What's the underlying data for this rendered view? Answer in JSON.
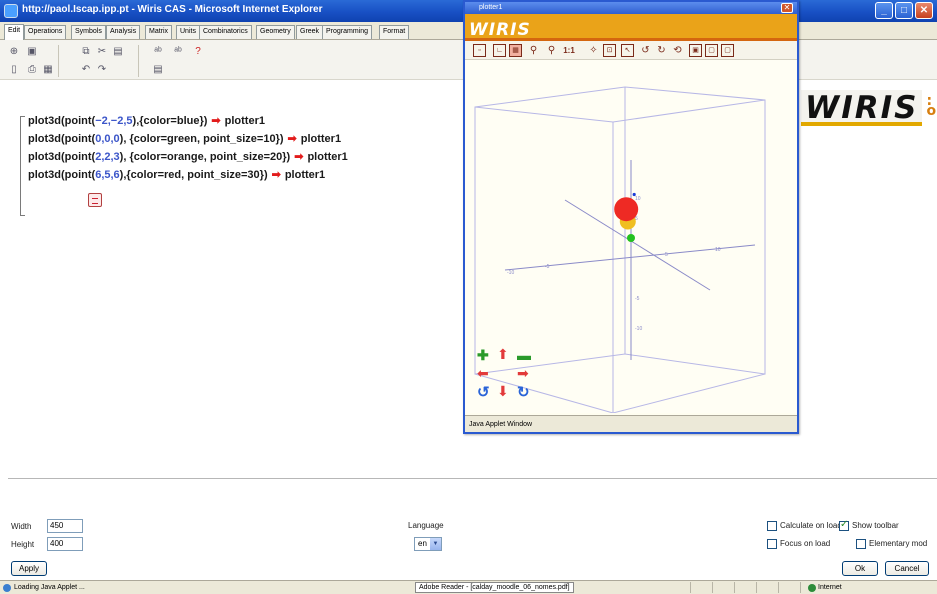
{
  "window": {
    "title": "http://paol.Iscap.ipp.pt - Wiris CAS - Microsoft Internet Explorer"
  },
  "tabs": [
    {
      "label": "Edit",
      "active": true
    },
    {
      "label": "Operations",
      "active": false
    },
    {
      "label": "Symbols",
      "active": false
    },
    {
      "label": "Analysis",
      "active": false
    },
    {
      "label": "Matrix",
      "active": false
    },
    {
      "label": "Units",
      "active": false
    },
    {
      "label": "Combinatorics",
      "active": false
    },
    {
      "label": "Geometry",
      "active": false
    },
    {
      "label": "Greek",
      "active": false
    },
    {
      "label": "Programming",
      "active": false
    },
    {
      "label": "Format",
      "active": false
    }
  ],
  "brand_logo": "WIRIS",
  "worksheet": {
    "lines": [
      {
        "cmd": "plot3d(point(",
        "args": "−2,−2,5",
        "mid": "),{color=blue})",
        "target": "plotter1"
      },
      {
        "cmd": "plot3d(point(",
        "args": "0,0,0",
        "mid": "), {color=green, point_size=10})",
        "target": "plotter1"
      },
      {
        "cmd": "plot3d(point(",
        "args": "2,2,3",
        "mid": "), {color=orange, point_size=20})",
        "target": "plotter1"
      },
      {
        "cmd": "plot3d(point(",
        "args": "6,5,6",
        "mid": "),{color=red, point_size=30})",
        "target": "plotter1"
      }
    ]
  },
  "plotter": {
    "title": "plotter1",
    "logo": "WIRIS",
    "status": "Java Applet Window",
    "points": [
      {
        "x": -2,
        "y": -2,
        "z": 5,
        "color": "blue",
        "size": 4
      },
      {
        "x": 0,
        "y": 0,
        "z": 0,
        "color": "green",
        "size": 10
      },
      {
        "x": 2,
        "y": 2,
        "z": 3,
        "color": "orange",
        "size": 20
      },
      {
        "x": 6,
        "y": 5,
        "z": 6,
        "color": "red",
        "size": 30
      }
    ],
    "toolbar_icons": [
      "window-icon",
      "axes-icon",
      "box-icon",
      "zoom-in-icon",
      "zoom-out-icon",
      "zoom-1to1-icon",
      "rotate-icon",
      "fit-icon",
      "select-icon",
      "redo-icon",
      "refresh-icon",
      "frame-icon",
      "grid-icon",
      "export-icon"
    ],
    "zoom_label": "1:1"
  },
  "form": {
    "width_label": "Width",
    "width_value": "450",
    "height_label": "Height",
    "height_value": "400",
    "apply_label": "Apply",
    "language_label": "Language",
    "language_value": "en",
    "calc_on_load_label": "Calculate on load",
    "calc_on_load_checked": false,
    "show_toolbar_label": "Show toolbar",
    "show_toolbar_checked": true,
    "focus_on_load_label": "Focus on load",
    "focus_on_load_checked": false,
    "elementary_label": "Elementary mod",
    "elementary_checked": false,
    "ok_label": "Ok",
    "cancel_label": "Cancel"
  },
  "statusbar": {
    "text": "Loading Java Applet ...",
    "taskbar_hint": "Adobe Reader - [calday_moodle_06_nomes.pdf]",
    "zone": "Internet"
  },
  "colors": {
    "accent": "#eaa319",
    "brand_band": "#d4660f",
    "arrow_red": "#e21b1b",
    "number_blue": "#3b55c9"
  }
}
